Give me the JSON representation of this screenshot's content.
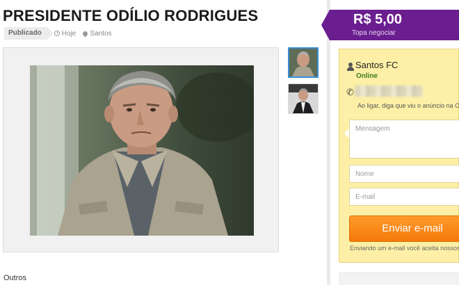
{
  "listing": {
    "title": "PRESIDENTE ODÍLIO RODRIGUES",
    "status_badge": "Publicado",
    "date": "Hoje",
    "location": "Santos",
    "category": "Outros"
  },
  "price": {
    "value": "R$ 5,00",
    "note": "Topa negociar"
  },
  "seller": {
    "name": "Santos FC",
    "status": "Online",
    "phone_note": "Ao ligar, diga que viu o anúncio na O"
  },
  "form": {
    "message_placeholder": "Mensagem",
    "name_placeholder": "Nome",
    "email_placeholder": "E-mail",
    "send_label": "Enviar e-mail",
    "legal_note": "Enviando um e-mail você aceita nossos"
  },
  "colors": {
    "price_tag": "#6b1e8f",
    "contact_box": "#fdf0a6",
    "send_button": "#f57a0a",
    "online": "#3a7a1e"
  }
}
